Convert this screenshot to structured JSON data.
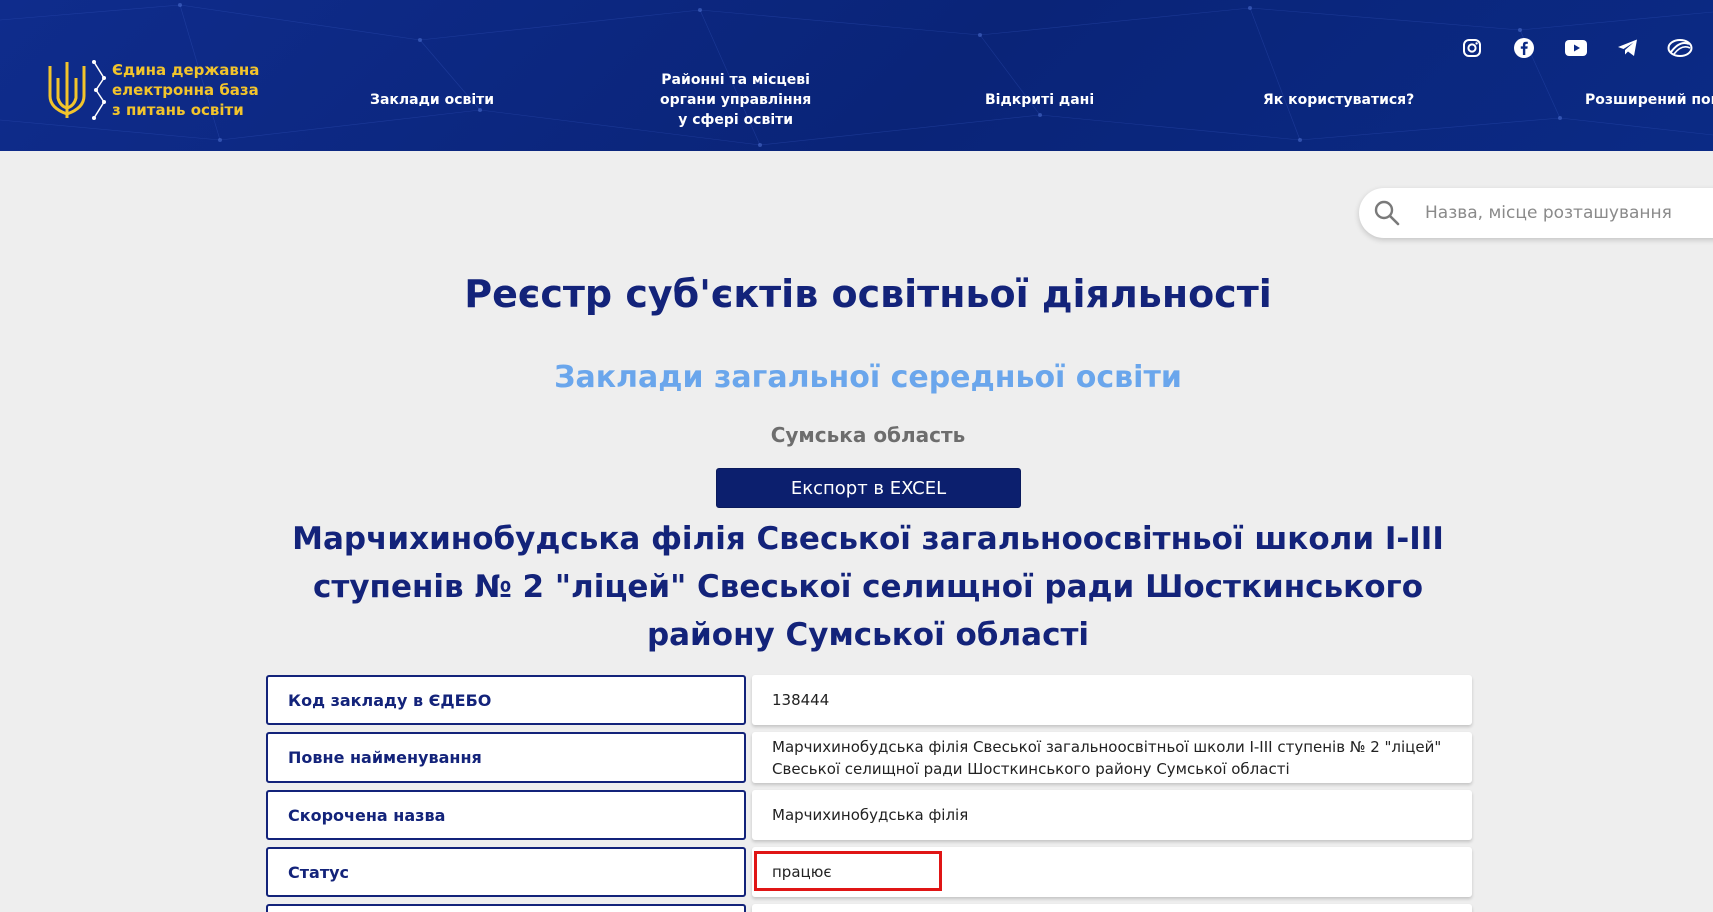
{
  "header": {
    "logo_lines": [
      "Єдина державна",
      "електронна база",
      "з питань освіти"
    ],
    "nav": [
      {
        "label": "Заклади освіти"
      },
      {
        "label_lines": [
          "Районні та місцеві",
          "органи управління",
          "у сфері освіти"
        ]
      },
      {
        "label": "Відкриті дані"
      },
      {
        "label": "Як користуватися?"
      },
      {
        "label": "Розширений пош"
      }
    ],
    "socials": [
      "instagram-icon",
      "facebook-icon",
      "youtube-icon",
      "telegram-icon",
      "website-icon"
    ]
  },
  "search": {
    "placeholder": "Назва, місце розташування"
  },
  "page": {
    "title": "Реєстр суб'єктів освітньої діяльності",
    "subtitle": "Заклади загальної середньої освіти",
    "region": "Сумська область",
    "export_label": "Експорт в EXCEL",
    "school_title": "Марчихинобудська філія Свеської загальноосвітньої школи І-ІІІ ступенів № 2 \"ліцей\" Свеської селищної ради Шосткинського району Сумської області"
  },
  "info_rows": [
    {
      "label": "Код закладу в ЄДЕБО",
      "value": "138444"
    },
    {
      "label": "Повне найменування",
      "value": "Марчихинобудська філія Свеської загальноосвітньої школи І-ІІІ ступенів № 2 \"ліцей\" Свеської селищної ради Шосткинського району Сумської області"
    },
    {
      "label": "Скорочена назва",
      "value": "Марчихинобудська філія"
    },
    {
      "label": "Статус",
      "value": "працює"
    }
  ],
  "colors": {
    "header_bg": "#0b2a85",
    "logo_gold": "#f2c42c",
    "heading_navy": "#13237a",
    "subtitle_blue": "#6aa6ec",
    "highlight_red": "#e01515"
  }
}
